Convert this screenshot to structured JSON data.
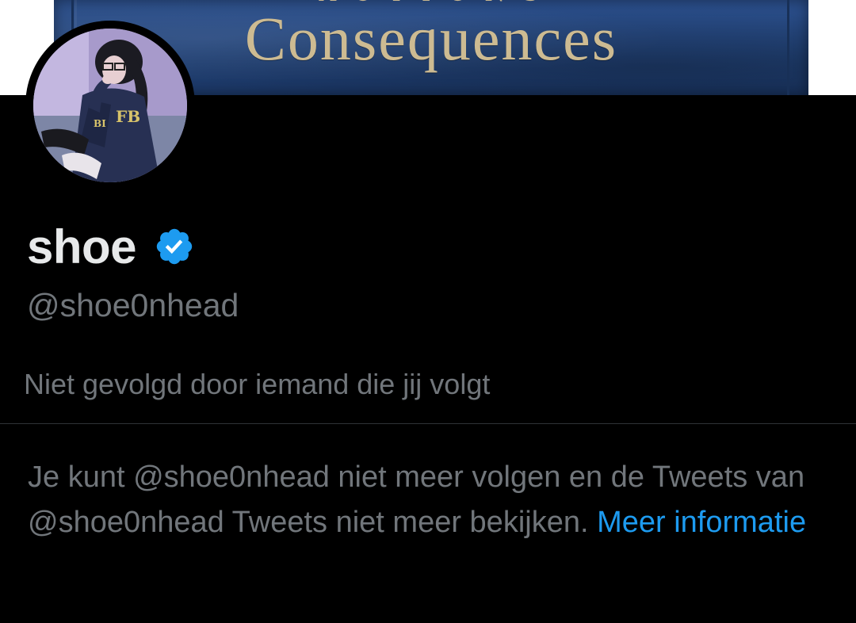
{
  "banner": {
    "title": "Consequences"
  },
  "profile": {
    "display_name": "shoe",
    "handle": "@shoe0nhead",
    "verified": true,
    "verified_icon": "verified-badge-icon",
    "follow_status": "Niet gevolgd door iemand die jij volgt"
  },
  "notice": {
    "text": "Je kunt @shoe0nhead niet meer volgen en de Tweets van @shoe0nhead Tweets niet meer bekijken.",
    "link_label": "Meer informatie"
  },
  "colors": {
    "background": "#000000",
    "primary_text": "#e7e9ea",
    "secondary_text": "#71767b",
    "accent": "#1d9bf0",
    "divider": "#2f3336",
    "banner_blue": "#224378"
  }
}
